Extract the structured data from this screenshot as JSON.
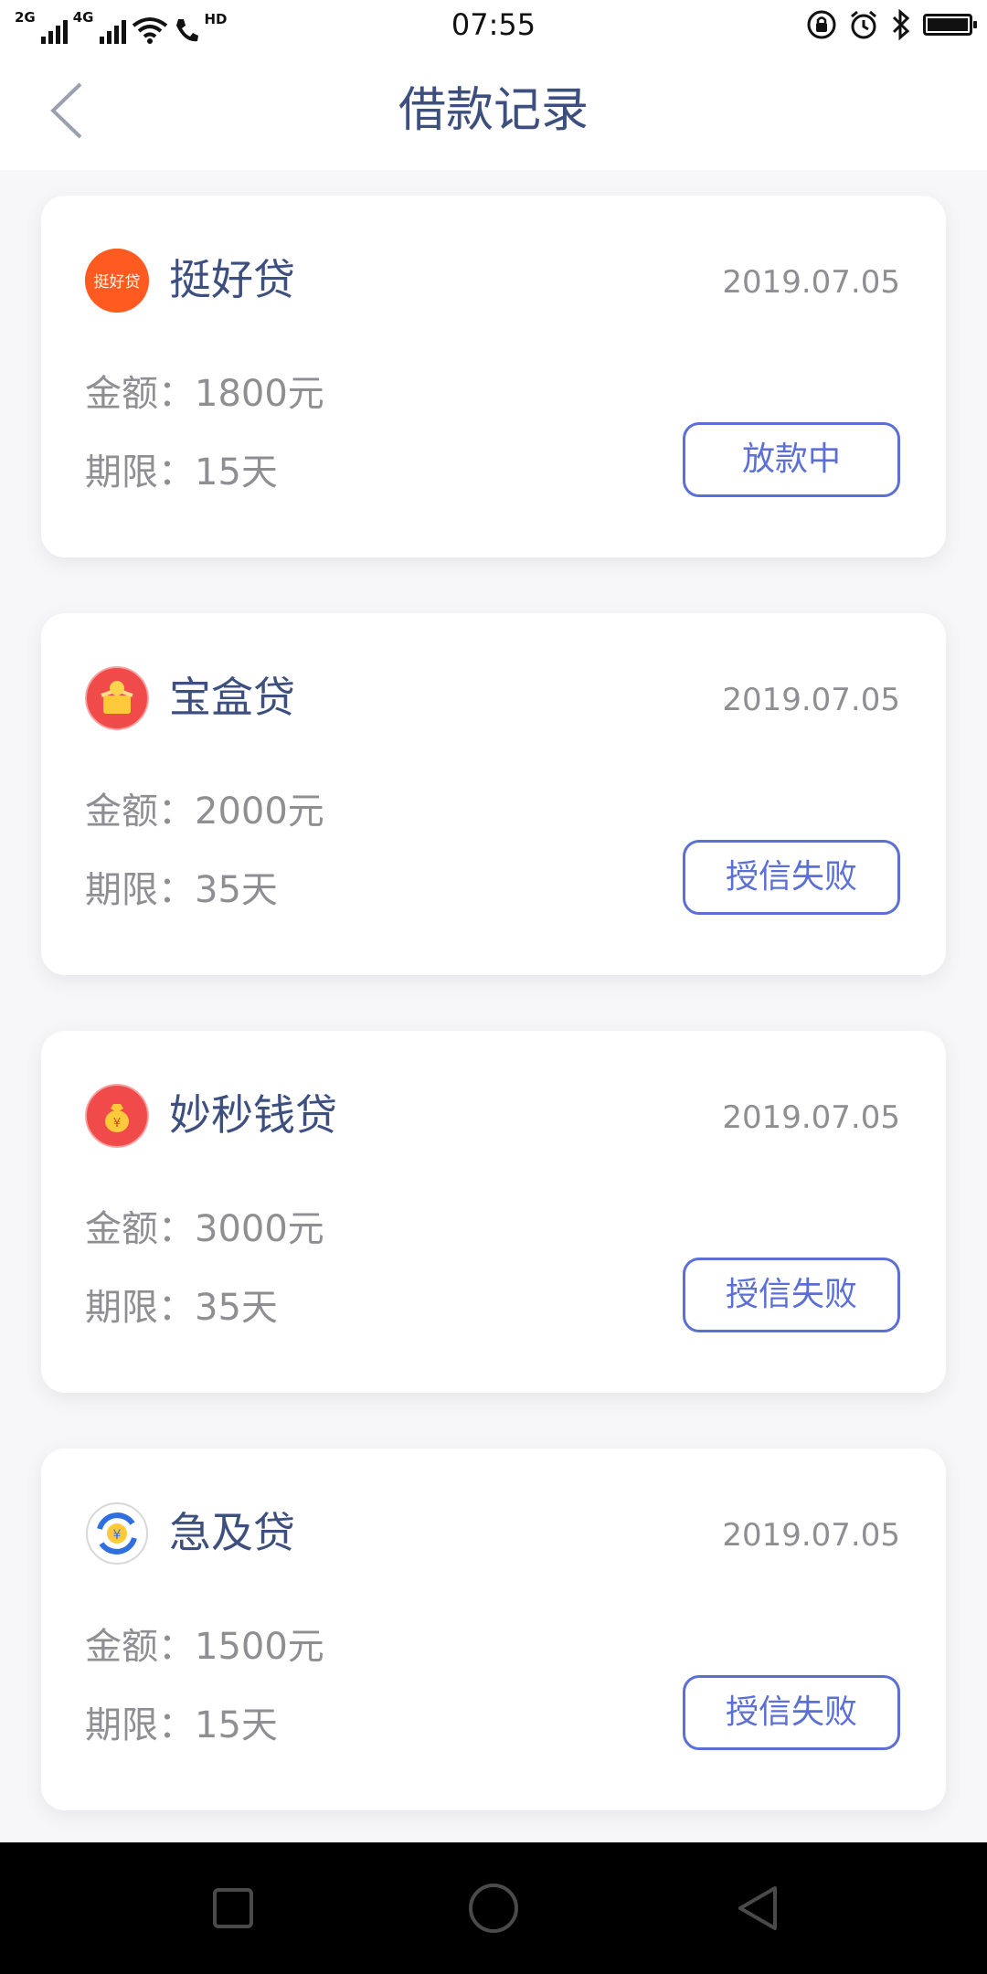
{
  "status_bar": {
    "network1": "2G",
    "network2": "4G",
    "hd": "HD",
    "time": "07:55",
    "battery_level": 0.95
  },
  "header": {
    "title": "借款记录"
  },
  "colors": {
    "title": "#3d4f7f",
    "accent": "#5b6fd6",
    "muted": "#8e8e93",
    "background": "#f7f7f9"
  },
  "records": [
    {
      "name": "挺好贷",
      "date": "2019.07.05",
      "amount": "金额：1800元",
      "term": "期限：15天",
      "status": "放款中",
      "logo_icon": "tinghaodai-logo-icon",
      "logo_text": "挺好贷"
    },
    {
      "name": "宝盒贷",
      "date": "2019.07.05",
      "amount": "金额：2000元",
      "term": "期限：35天",
      "status": "授信失败",
      "logo_icon": "treasure-box-logo-icon"
    },
    {
      "name": "妙秒钱贷",
      "date": "2019.07.05",
      "amount": "金额：3000元",
      "term": "期限：35天",
      "status": "授信失败",
      "logo_icon": "money-bag-logo-icon"
    },
    {
      "name": "急及贷",
      "date": "2019.07.05",
      "amount": "金额：1500元",
      "term": "期限：15天",
      "status": "授信失败",
      "logo_icon": "yuan-exchange-logo-icon"
    }
  ],
  "nav_bar": {
    "recent_icon": "square-icon",
    "home_icon": "circle-icon",
    "back_icon": "triangle-back-icon"
  }
}
